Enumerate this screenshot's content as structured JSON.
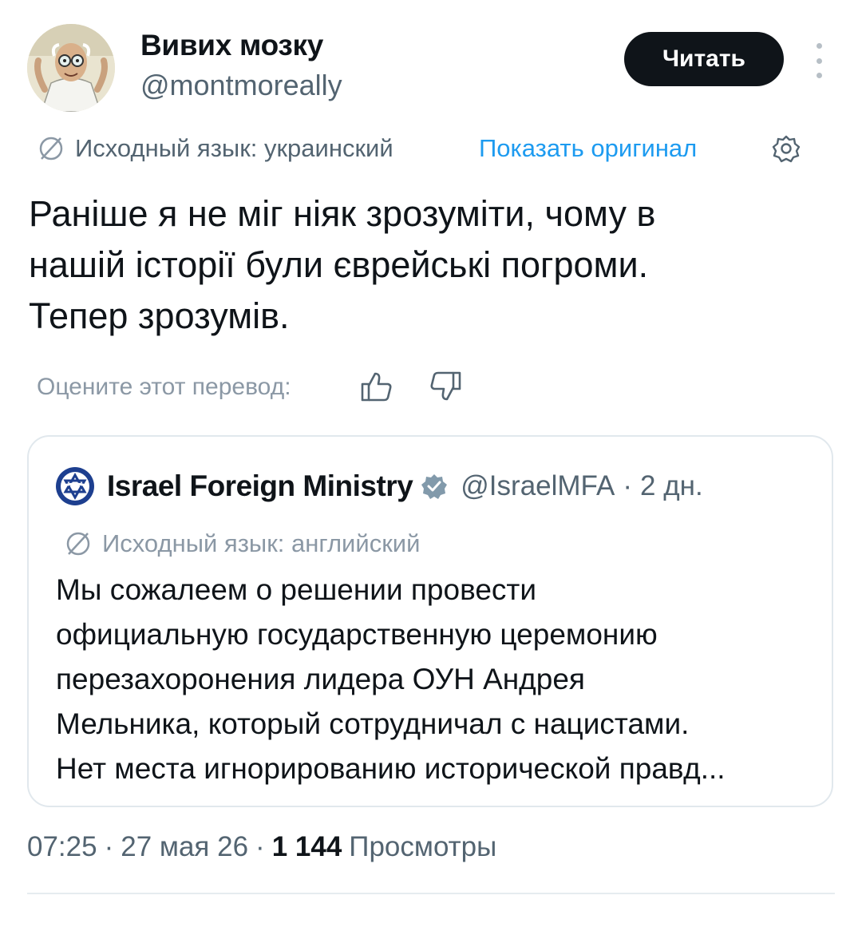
{
  "author": {
    "name": "Вивих мозку",
    "handle": "@montmoreally"
  },
  "follow_button_label": "Читать",
  "translation_bar": {
    "source_language": "Исходный язык: украинский",
    "show_original": "Показать оригинал"
  },
  "tweet_text": [
    "Раніше я не міг ніяк зрозуміти, чому в",
    "нашій історії були єврейські погроми.",
    "Тепер зрозумів."
  ],
  "rate_translation_label": "Оцените этот перевод:",
  "quote": {
    "author_name": "Israel Foreign Ministry",
    "handle": "@IsraelMFA",
    "separator": "·",
    "age": "2 дн.",
    "source_language": "Исходный язык: английский",
    "text": [
      "Мы сожалеем о решении провести",
      "официальную государственную церемонию",
      "перезахоронения лидера ОУН Андрея",
      "Мельника, который сотрудничал с нацистами.",
      "Нет места игнорированию исторической правд..."
    ]
  },
  "footer": {
    "time": "07:25",
    "separator": "·",
    "date": "27 мая 26",
    "views_count": "1 144",
    "views_label": "Просмотры"
  },
  "colors": {
    "link": "#1d9bf0",
    "secondary_text": "#536471",
    "verified_badge": "#829aab",
    "follow_button_bg": "#0f1419"
  },
  "icons": [
    "avatar-image",
    "more-options-icon",
    "translate-globe-icon",
    "settings-gear-icon",
    "thumbs-up-icon",
    "thumbs-down-icon",
    "israel-mfa-logo",
    "verified-badge-icon"
  ]
}
